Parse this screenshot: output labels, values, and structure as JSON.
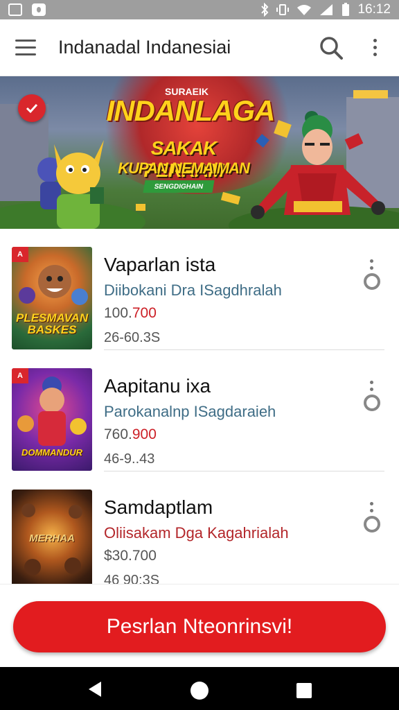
{
  "status_bar": {
    "time": "16:12"
  },
  "app_bar": {
    "title": "Indanadal Indanesiai"
  },
  "banner": {
    "kicker": "SURAEIK",
    "title": "INDANLAGA",
    "subtitle_1": "SAKAK PERRAM",
    "subtitle_2": "KUPAN NEMAIMAN",
    "ribbon": "SENGDIGHAIN"
  },
  "items": [
    {
      "title": "Vaparlan ista",
      "subtitle": "Diibokani Dra ISagdhralah",
      "price_prefix": "100.",
      "price_accent": "700",
      "meta": "26-60.3S",
      "thumb_label": "PLESMAVAN BASKES",
      "thumb_tag": "A"
    },
    {
      "title": "Aapitanu ixa",
      "subtitle": "Parokanalnp ISagdaraieh",
      "price_prefix": "760.",
      "price_accent": "900",
      "meta": "46-9..43",
      "thumb_label": "DOMMANDUR",
      "thumb_tag": "A"
    },
    {
      "title": "Samdaptlam",
      "subtitle": "Oliisakam Dga Kagahrialah",
      "price_prefix": "$30.700",
      "price_accent": "",
      "meta": "46 90:3S",
      "thumb_label": "MERHAA",
      "thumb_tag": ""
    }
  ],
  "cta": {
    "label": "Pesrlan Nteonrinsvi!"
  },
  "colors": {
    "accent": "#e21c1f",
    "subtitle_blue": "#3f6d86",
    "subtitle_red": "#b3262a"
  }
}
